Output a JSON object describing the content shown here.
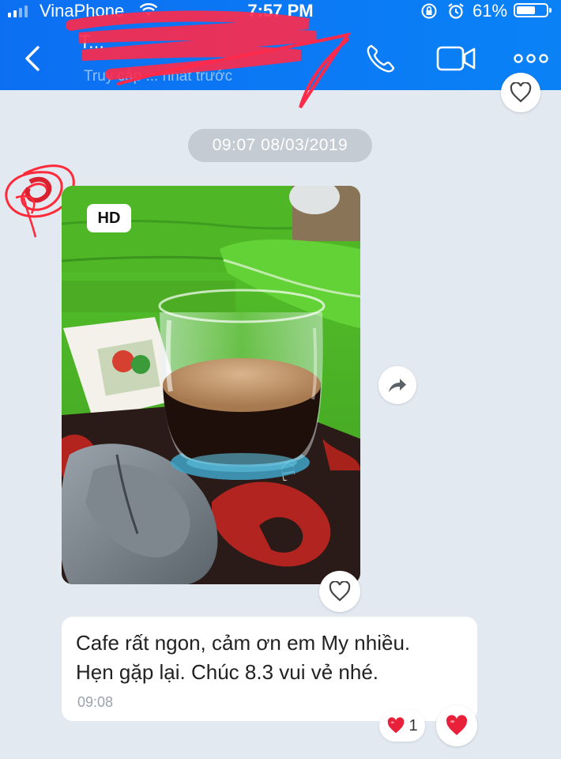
{
  "status_bar": {
    "carrier": "VinaPhone",
    "time": "7:57 PM",
    "battery_percent": "61%",
    "battery_level": 0.61
  },
  "header": {
    "contact_name": "T...",
    "contact_status": "Truy cập ... nhất trước"
  },
  "chat": {
    "date_separator": "09:07 08/03/2019",
    "photo": {
      "badge": "HD"
    },
    "message": {
      "line1": "Cafe rất ngon, cảm ơn em My nhiều.",
      "line2": "Hẹn gặp lại. Chúc 8.3 vui vẻ nhé.",
      "time": "09:08"
    },
    "reaction": {
      "emoji": "heart",
      "count": "1"
    }
  },
  "colors": {
    "header_blue": "#0a7cf5",
    "chat_bg": "#e3e9f1",
    "heart_red": "#e8203a"
  }
}
